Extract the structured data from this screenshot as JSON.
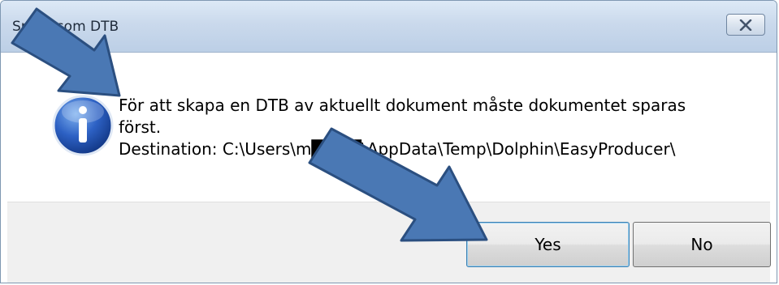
{
  "window": {
    "title": "Spara som DTB"
  },
  "message": {
    "line1": "För att skapa en DTB av aktuellt dokument måste dokumentet sparas",
    "line2": "först.",
    "line3": "Destination: C:\\Users\\m████\\AppData\\Temp\\Dolphin\\EasyProducer\\"
  },
  "buttons": {
    "yes_label": "Yes",
    "no_label": "No"
  },
  "icons": {
    "message_icon": "info-icon",
    "close_icon": "close-x-icon"
  },
  "colors": {
    "arrow_fill": "#4a78b4",
    "arrow_stroke": "#2b4f80",
    "icon_blue": "#1f4fa8",
    "dialog_border": "#7f98b2"
  }
}
